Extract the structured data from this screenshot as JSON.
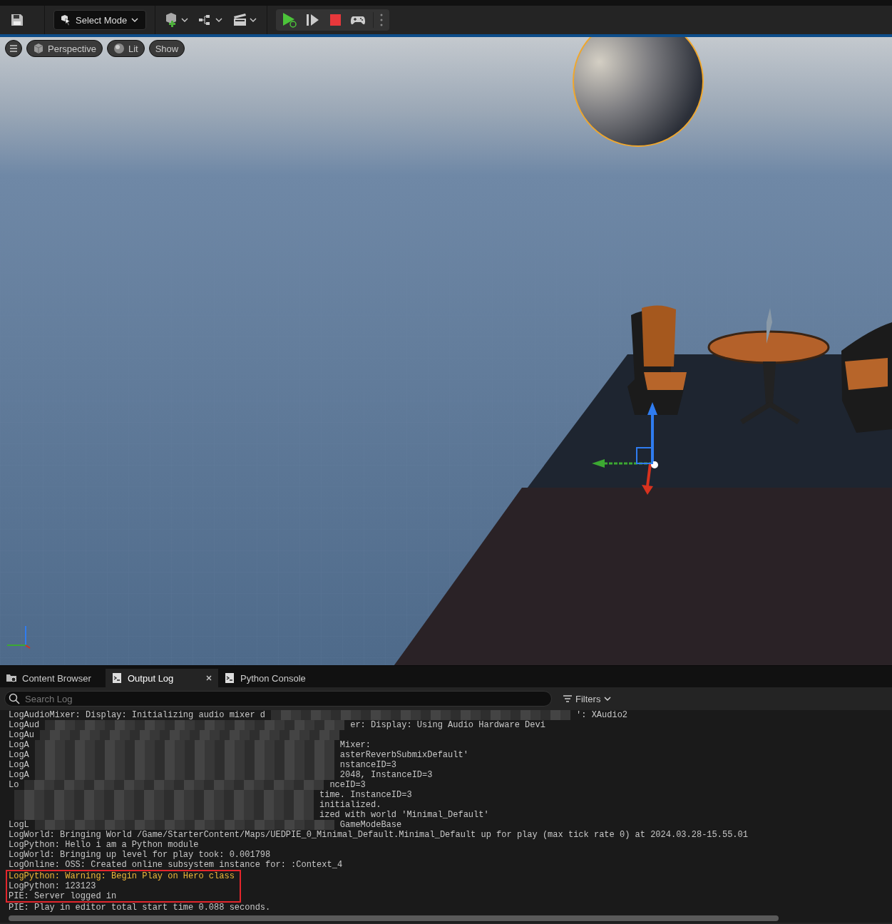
{
  "toolbar": {
    "mode_button": {
      "label": "Select Mode"
    }
  },
  "viewport": {
    "buttons": [
      {
        "kind": "menu"
      },
      {
        "kind": "cube",
        "label": "Perspective"
      },
      {
        "kind": "sphere",
        "label": "Lit"
      },
      {
        "kind": "plain",
        "label": "Show"
      }
    ]
  },
  "tabs": [
    {
      "kind": "folder",
      "label": "Content Browser",
      "selected": false,
      "closable": false
    },
    {
      "kind": "log",
      "label": "Output Log",
      "selected": true,
      "closable": true
    },
    {
      "kind": "log",
      "label": "Python Console",
      "selected": false,
      "closable": false
    }
  ],
  "search": {
    "placeholder": "Search Log"
  },
  "filters": {
    "label": "Filters"
  },
  "log_lines": [
    {
      "kind": "display",
      "left": "LogAudioMixer: Display: Initializing audio mixer d",
      "right": "': XAudio2",
      "redacted": true,
      "highlighted": false
    },
    {
      "kind": "display",
      "left": "LogAud",
      "right": "er: Display: Using Audio Hardware Devi",
      "redacted": true,
      "highlighted": false
    },
    {
      "kind": "display",
      "left": "LogAu",
      "redacted": true,
      "highlighted": false
    },
    {
      "kind": "display",
      "left": "LogA",
      "right": "Mixer:",
      "redacted": true,
      "highlighted": false
    },
    {
      "kind": "display",
      "left": "LogA",
      "right": "asterReverbSubmixDefault'",
      "redacted": true,
      "highlighted": false
    },
    {
      "kind": "display",
      "left": "LogA",
      "right": "nstanceID=3",
      "redacted": true,
      "highlighted": false
    },
    {
      "kind": "display",
      "left": "LogA",
      "right": "2048, InstanceID=3",
      "redacted": true,
      "highlighted": false
    },
    {
      "kind": "display",
      "left": "Lo",
      "right": "nceID=3",
      "redacted": true,
      "highlighted": false
    },
    {
      "kind": "display",
      "right": "time. InstanceID=3",
      "redacted": true,
      "highlighted": false
    },
    {
      "kind": "display",
      "right": "initialized.",
      "redacted": true,
      "highlighted": false
    },
    {
      "kind": "display",
      "right": "ized with world 'Minimal_Default'",
      "redacted": true,
      "highlighted": false
    },
    {
      "kind": "display",
      "left": "LogL",
      "right": "GameModeBase",
      "redacted": true,
      "highlighted": false
    },
    {
      "kind": "display",
      "left": "LogWorld: Bringing World /Game/StarterContent/Maps/UEDPIE_0_Minimal_Default.Minimal_Default up for play (max tick rate 0) at 2024.03.28-15.55.01",
      "redacted": false,
      "highlighted": false
    },
    {
      "kind": "display",
      "left": "LogPython: Hello i am a Python module",
      "redacted": false,
      "highlighted": false
    },
    {
      "kind": "display",
      "left": "LogWorld: Bringing up level for play took: 0.001798",
      "redacted": false,
      "highlighted": false
    },
    {
      "kind": "display",
      "left": "LogOnline: OSS: Created online subsystem instance for: :Context_4",
      "redacted": false,
      "highlighted": false
    },
    {
      "kind": "warning",
      "left": "LogPython: Warning: Begin Play on Hero class",
      "redacted": false,
      "highlighted": true
    },
    {
      "kind": "display",
      "left": "LogPython: 123123",
      "redacted": false,
      "highlighted": true
    },
    {
      "kind": "display",
      "left": "PIE: Server logged in",
      "redacted": false,
      "highlighted": true
    },
    {
      "kind": "display",
      "left": "PIE: Play in editor total start time 0.088 seconds.",
      "redacted": false,
      "highlighted": false
    }
  ]
}
